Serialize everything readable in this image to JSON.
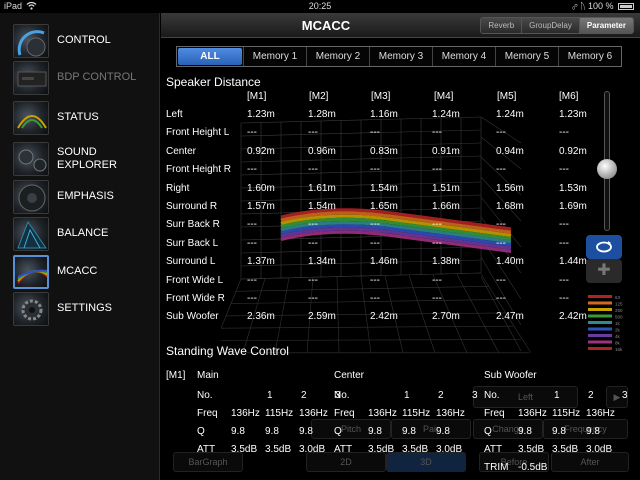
{
  "status_bar": {
    "carrier": "iPad",
    "time": "20:25",
    "battery": "100 %"
  },
  "sidebar": {
    "items": [
      {
        "label": "CONTROL",
        "icon": "knob-icon",
        "active": false,
        "dim": false
      },
      {
        "label": "BDP CONTROL",
        "icon": "bdp-icon",
        "active": false,
        "dim": true
      },
      {
        "label": "STATUS",
        "icon": "status-icon",
        "active": false,
        "dim": false
      },
      {
        "label": "SOUND\nEXPLORER",
        "icon": "sound-explorer-icon",
        "active": false,
        "dim": false
      },
      {
        "label": "EMPHASIS",
        "icon": "speaker-icon",
        "active": false,
        "dim": false
      },
      {
        "label": "BALANCE",
        "icon": "balance-icon",
        "active": false,
        "dim": false
      },
      {
        "label": "MCACC",
        "icon": "mcacc-icon",
        "active": true,
        "dim": false
      },
      {
        "label": "SETTINGS",
        "icon": "settings-icon",
        "active": false,
        "dim": false
      }
    ]
  },
  "header": {
    "title": "MCACC",
    "modes": [
      {
        "label": "Reverb",
        "active": false
      },
      {
        "label": "GroupDelay",
        "active": false
      },
      {
        "label": "Parameter",
        "active": true
      }
    ]
  },
  "memory_tabs": [
    {
      "label": "ALL",
      "active": true
    },
    {
      "label": "Memory 1",
      "active": false
    },
    {
      "label": "Memory 2",
      "active": false
    },
    {
      "label": "Memory 3",
      "active": false
    },
    {
      "label": "Memory 4",
      "active": false
    },
    {
      "label": "Memory 5",
      "active": false
    },
    {
      "label": "Memory 6",
      "active": false
    }
  ],
  "speaker_distance": {
    "title": "Speaker Distance",
    "columns": [
      "[M1]",
      "[M2]",
      "[M3]",
      "[M4]",
      "[M5]",
      "[M6]"
    ],
    "rows": [
      {
        "label": "Left",
        "values": [
          "1.23m",
          "1.28m",
          "1.16m",
          "1.24m",
          "1.24m",
          "1.23m"
        ]
      },
      {
        "label": "Front Height L",
        "values": [
          "---",
          "---",
          "---",
          "---",
          "---",
          "---"
        ]
      },
      {
        "label": "Center",
        "values": [
          "0.92m",
          "0.96m",
          "0.83m",
          "0.91m",
          "0.94m",
          "0.92m"
        ]
      },
      {
        "label": "Front Height R",
        "values": [
          "---",
          "---",
          "---",
          "---",
          "---",
          "---"
        ]
      },
      {
        "label": "Right",
        "values": [
          "1.60m",
          "1.61m",
          "1.54m",
          "1.51m",
          "1.56m",
          "1.53m"
        ]
      },
      {
        "label": "Surround R",
        "values": [
          "1.57m",
          "1.54m",
          "1.65m",
          "1.66m",
          "1.68m",
          "1.69m"
        ]
      },
      {
        "label": "Surr Back R",
        "values": [
          "---",
          "---",
          "---",
          "---",
          "---",
          "---"
        ]
      },
      {
        "label": "Surr Back L",
        "values": [
          "---",
          "---",
          "---",
          "---",
          "---",
          "---"
        ]
      },
      {
        "label": "Surround L",
        "values": [
          "1.37m",
          "1.34m",
          "1.46m",
          "1.38m",
          "1.40m",
          "1.44m"
        ]
      },
      {
        "label": "Front Wide L",
        "values": [
          "---",
          "---",
          "---",
          "---",
          "---",
          "---"
        ]
      },
      {
        "label": "Front Wide R",
        "values": [
          "---",
          "---",
          "---",
          "---",
          "---",
          "---"
        ]
      },
      {
        "label": "Sub Woofer",
        "values": [
          "2.36m",
          "2.59m",
          "2.42m",
          "2.70m",
          "2.47m",
          "2.42m"
        ]
      }
    ]
  },
  "standing_wave": {
    "title": "Standing Wave Control",
    "memory": "[M1]",
    "groups": [
      {
        "name": "Main",
        "numbers": [
          "1",
          "2",
          "3"
        ],
        "freq": [
          "136Hz",
          "115Hz",
          "136Hz"
        ],
        "q": [
          "9.8",
          "9.8",
          "9.8"
        ],
        "att": [
          "3.5dB",
          "3.5dB",
          "3.0dB"
        ]
      },
      {
        "name": "Center",
        "numbers": [
          "1",
          "2",
          "3"
        ],
        "freq": [
          "136Hz",
          "115Hz",
          "136Hz"
        ],
        "q": [
          "9.8",
          "9.8",
          "9.8"
        ],
        "att": [
          "3.5dB",
          "3.5dB",
          "3.0dB"
        ]
      },
      {
        "name": "Sub Woofer",
        "numbers": [
          "1",
          "2",
          "3"
        ],
        "freq": [
          "136Hz",
          "115Hz",
          "136Hz"
        ],
        "q": [
          "9.8",
          "9.8",
          "9.8"
        ],
        "att": [
          "3.5dB",
          "3.5dB",
          "3.0dB"
        ]
      }
    ],
    "row_labels": {
      "no": "No.",
      "freq": "Freq",
      "q": "Q",
      "att": "ATT",
      "trim": "TRIM"
    },
    "trim_value": "-0.5dB"
  },
  "ghost_controls": {
    "left": "Left",
    "bargraph": "BarGraph",
    "view_2d": "2D",
    "view_3d": "3D",
    "before": "Before",
    "after": "After",
    "pitch": "Pitch",
    "pair": "Pair",
    "change": "Change",
    "frequency": "Frequency"
  },
  "colors": {
    "accent": "#3a78d6",
    "band_colors": [
      "#b22222",
      "#d2691e",
      "#c8a000",
      "#3a9a3a",
      "#2e8b8b",
      "#3050c0",
      "#6a3aa0",
      "#a03080"
    ]
  },
  "legend_labels": [
    "63",
    "125",
    "250",
    "500",
    "1k",
    "2k",
    "4k",
    "8k",
    "16k"
  ]
}
